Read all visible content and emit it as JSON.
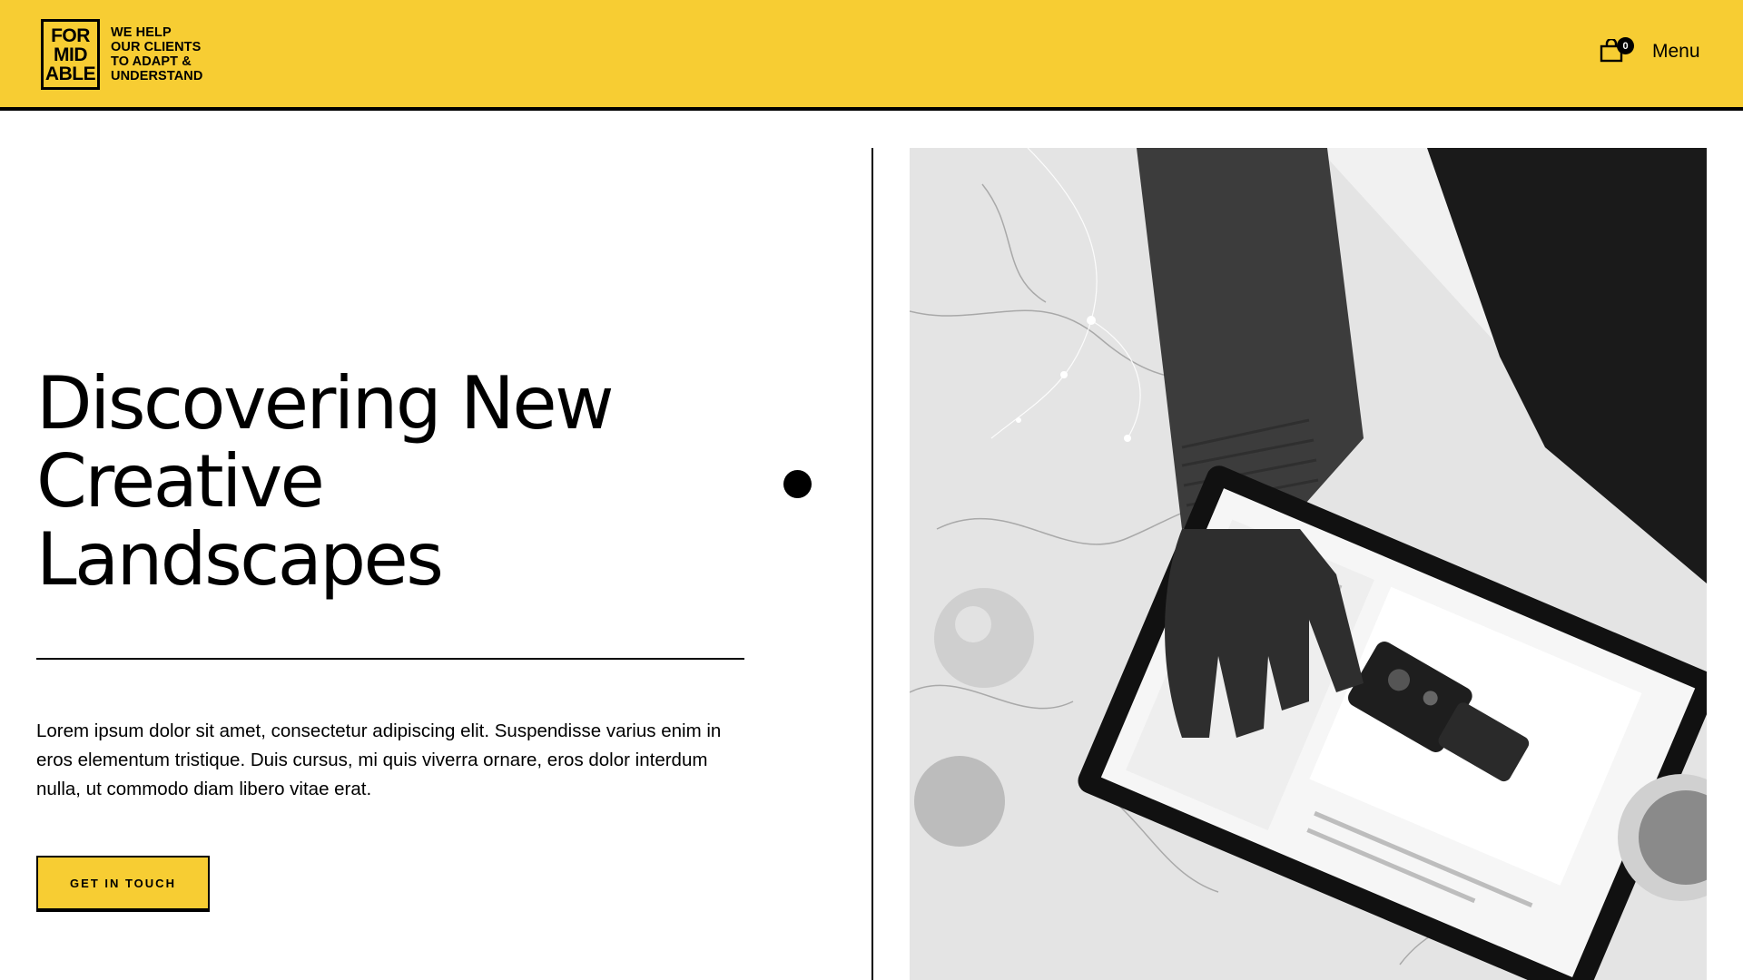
{
  "header": {
    "logo": {
      "lines": [
        "FOR",
        "MID",
        "ABLE"
      ]
    },
    "tagline": [
      "We help",
      "our clients",
      "to adapt &",
      "understand"
    ],
    "cart": {
      "icon": "shopping-bag-icon",
      "count": "0"
    },
    "menu_label": "Menu"
  },
  "hero": {
    "title_lines": [
      "Discovering New",
      "Creative",
      "Landscapes"
    ],
    "body": "Lorem ipsum dolor sit amet, consectetur adipiscing elit. Suspendisse varius enim in eros elementum tristique. Duis cursus, mi quis viverra ornare, eros dolor interdum nulla, ut commodo diam libero vitae erat.",
    "cta_label": "Get in touch"
  },
  "colors": {
    "accent": "#f7cd33",
    "ink": "#000000",
    "background": "#ffffff"
  }
}
